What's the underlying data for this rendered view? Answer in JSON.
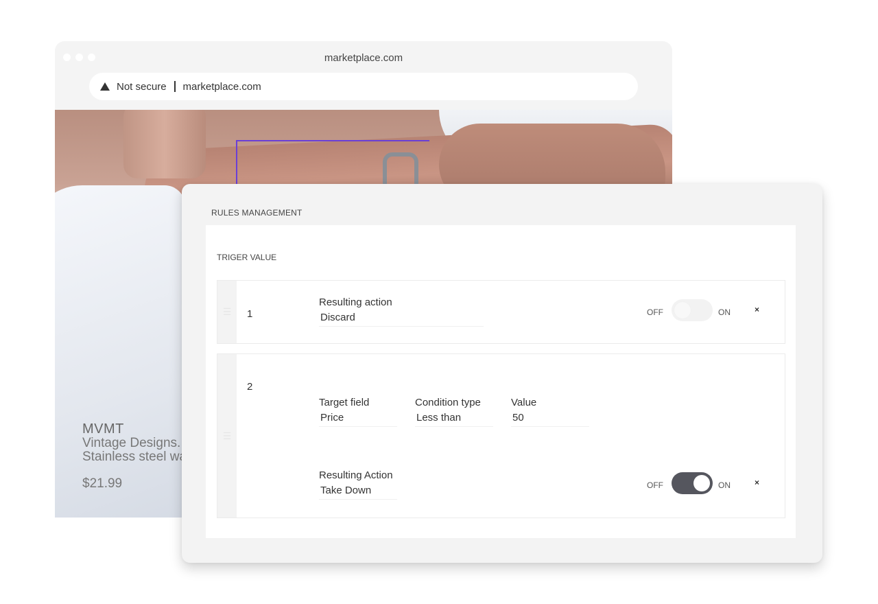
{
  "browser": {
    "window_title": "marketplace.com",
    "security_label": "Not secure",
    "url": "marketplace.com"
  },
  "product": {
    "brand": "MVMT",
    "description_line1": "Vintage Designs.",
    "description_line2": "Stainless steel wa",
    "price": "$21.99"
  },
  "rules_panel": {
    "title": "RULES MANAGEMENT",
    "section_title": "TRIGER VALUE",
    "rules": [
      {
        "number": "1",
        "action_label": "Resulting action",
        "action_value": "Discard",
        "toggle_off_label": "OFF",
        "toggle_on_label": "ON",
        "toggle_enabled": false
      },
      {
        "number": "2",
        "target_field_label": "Target field",
        "target_field_value": "Price",
        "condition_type_label": "Condition type",
        "condition_type_value": "Less than",
        "value_label": "Value",
        "value_value": "50",
        "action_label": "Resulting Action",
        "action_value": "Take Down",
        "toggle_off_label": "OFF",
        "toggle_on_label": "ON",
        "toggle_enabled": true
      }
    ]
  },
  "icons": {
    "close": "×",
    "drag_handle": "☰"
  },
  "colors": {
    "selection_frame": "#6a3fd6",
    "toggle_on": "#55565e"
  }
}
